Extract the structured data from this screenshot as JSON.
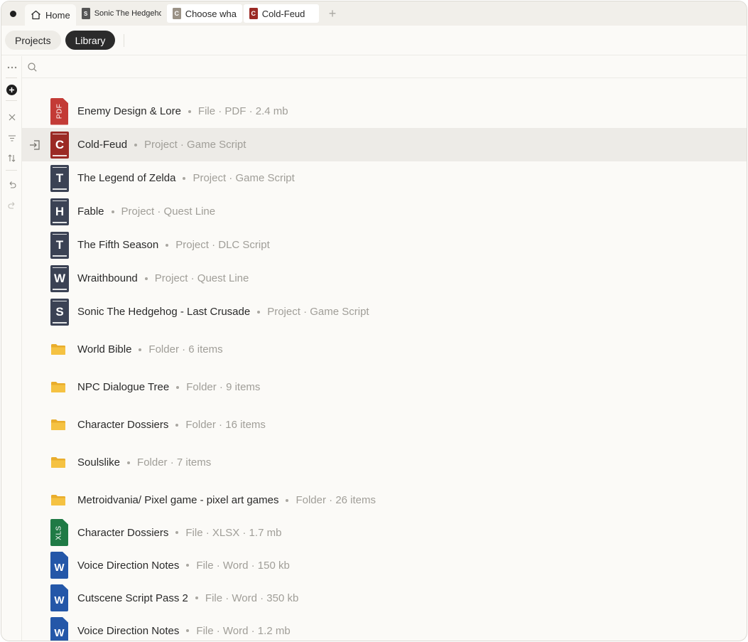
{
  "tabs": [
    {
      "label": "Home",
      "icon": "home-icon",
      "active": true
    },
    {
      "label": "Sonic The Hedgehog",
      "letter": "S",
      "color": "#555555"
    },
    {
      "label": "Choose what",
      "letter": "C",
      "color": "#9b9286"
    },
    {
      "label": "Cold-Feud",
      "letter": "C",
      "color": "#9b2a24"
    }
  ],
  "toolbar": {
    "projects_label": "Projects",
    "library_label": "Library"
  },
  "search": {
    "value": ""
  },
  "colors": {
    "book_navy": "#3b4254",
    "book_red": "#9b2a24",
    "pdf_red": "#c33b36",
    "xls_green": "#1f7a45",
    "word_blue": "#2457a8",
    "folder_yellow": "#f5c242"
  },
  "items": [
    {
      "name": "Enemy Design & Lore",
      "meta": "File · PDF · 2.4 mb",
      "kind": "pdf",
      "badge": "PDF"
    },
    {
      "name": "Cold-Feud",
      "meta": "Project · Game Script",
      "kind": "book",
      "letter": "C",
      "color": "#9b2a24",
      "selected": true
    },
    {
      "name": "The Legend of Zelda",
      "meta": "Project · Game Script",
      "kind": "book",
      "letter": "T",
      "color": "#3b4254"
    },
    {
      "name": "Fable",
      "meta": "Project · Quest Line",
      "kind": "book",
      "letter": "H",
      "color": "#3b4254"
    },
    {
      "name": "The Fifth Season",
      "meta": "Project · DLC Script",
      "kind": "book",
      "letter": "T",
      "color": "#3b4254"
    },
    {
      "name": "Wraithbound",
      "meta": "Project · Quest Line",
      "kind": "book",
      "letter": "W",
      "color": "#3b4254"
    },
    {
      "name": "Sonic The Hedgehog - Last Crusade",
      "meta": "Project · Game Script",
      "kind": "book",
      "letter": "S",
      "color": "#3b4254"
    },
    {
      "name": "World Bible",
      "meta": "Folder · 6 items",
      "kind": "folder"
    },
    {
      "name": "NPC Dialogue Tree",
      "meta": "Folder · 9 items",
      "kind": "folder"
    },
    {
      "name": "Character Dossiers",
      "meta": "Folder · 16 items",
      "kind": "folder"
    },
    {
      "name": "Soulslike",
      "meta": "Folder · 7 items",
      "kind": "folder"
    },
    {
      "name": "Metroidvania/ Pixel game - pixel art games",
      "meta": "Folder · 26 items",
      "kind": "folder"
    },
    {
      "name": "Character Dossiers",
      "meta": "File · XLSX · 1.7 mb",
      "kind": "xls",
      "badge": "XLS"
    },
    {
      "name": "Voice Direction Notes",
      "meta": "File · Word · 150 kb",
      "kind": "word",
      "badge": "W"
    },
    {
      "name": "Cutscene Script Pass 2",
      "meta": "File · Word · 350 kb",
      "kind": "word",
      "badge": "W"
    },
    {
      "name": "Voice Direction Notes",
      "meta": "File · Word · 1.2 mb",
      "kind": "word",
      "badge": "W"
    }
  ]
}
